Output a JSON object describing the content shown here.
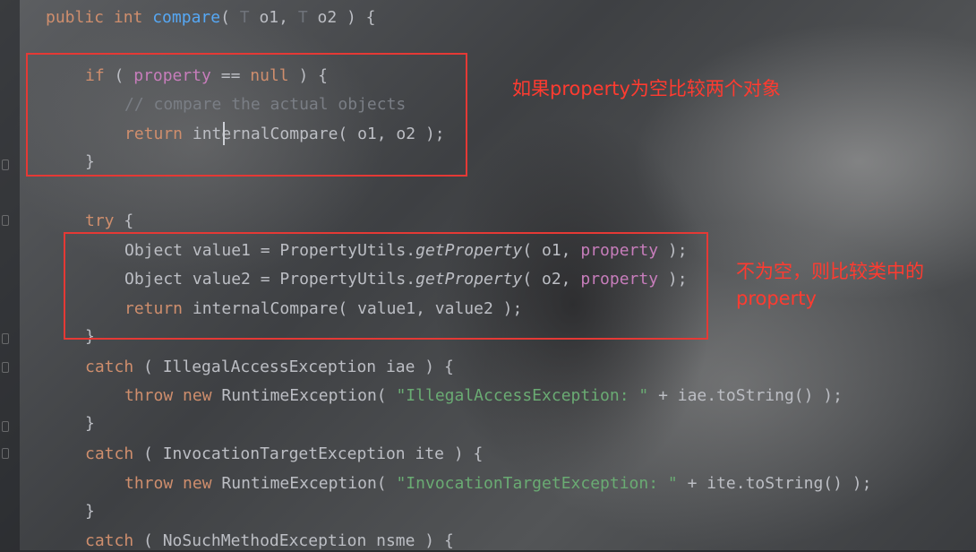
{
  "code_lines": [
    {
      "parts": [
        [
          "kw",
          "public "
        ],
        [
          "kw",
          "int "
        ],
        [
          "fn",
          "compare"
        ],
        [
          "",
          "( "
        ],
        [
          "par",
          "T "
        ],
        [
          "",
          "o1, "
        ],
        [
          "par",
          "T "
        ],
        [
          "",
          "o2 ) {"
        ]
      ]
    },
    {
      "parts": [
        [
          "kw",
          "if "
        ],
        [
          "",
          "( "
        ],
        [
          "fld",
          "property "
        ],
        [
          "",
          "== "
        ],
        [
          "kw",
          "null "
        ],
        [
          "",
          ") {"
        ]
      ]
    },
    {
      "parts": [
        [
          "cm",
          "// compare the actual objects"
        ]
      ]
    },
    {
      "parts": [
        [
          "kw",
          "return "
        ],
        [
          "",
          "internalCompare( o1, o2 );"
        ]
      ]
    },
    {
      "parts": [
        [
          "",
          "}"
        ]
      ]
    },
    {
      "parts": [
        [
          "kw",
          "try "
        ],
        [
          "",
          "{"
        ]
      ]
    },
    {
      "parts": [
        [
          "",
          "Object value1 = PropertyUtils."
        ],
        [
          "mcall",
          "getProperty"
        ],
        [
          "",
          "( o1, "
        ],
        [
          "fld",
          "property "
        ],
        [
          "",
          ");"
        ]
      ]
    },
    {
      "parts": [
        [
          "",
          "Object value2 = PropertyUtils."
        ],
        [
          "mcall",
          "getProperty"
        ],
        [
          "",
          "( o2, "
        ],
        [
          "fld",
          "property "
        ],
        [
          "",
          ");"
        ]
      ]
    },
    {
      "parts": [
        [
          "kw",
          "return "
        ],
        [
          "",
          "internalCompare( value1, value2 );"
        ]
      ]
    },
    {
      "parts": [
        [
          "",
          "}"
        ]
      ]
    },
    {
      "parts": [
        [
          "kw",
          "catch "
        ],
        [
          "",
          "( IllegalAccessException iae ) {"
        ]
      ]
    },
    {
      "parts": [
        [
          "kw",
          "throw "
        ],
        [
          "kw",
          "new "
        ],
        [
          "",
          "RuntimeException( "
        ],
        [
          "str",
          "\"IllegalAccessException: \" "
        ],
        [
          "",
          "+ iae.toString() );"
        ]
      ]
    },
    {
      "parts": [
        [
          "",
          "}"
        ]
      ]
    },
    {
      "parts": [
        [
          "kw",
          "catch "
        ],
        [
          "",
          "( InvocationTargetException ite ) {"
        ]
      ]
    },
    {
      "parts": [
        [
          "kw",
          "throw "
        ],
        [
          "kw",
          "new "
        ],
        [
          "",
          "RuntimeException( "
        ],
        [
          "str",
          "\"InvocationTargetException: \" "
        ],
        [
          "",
          "+ ite.toString() );"
        ]
      ]
    },
    {
      "parts": [
        [
          "",
          "}"
        ]
      ]
    },
    {
      "parts": [
        [
          "kw",
          "catch "
        ],
        [
          "",
          "( NoSuchMethodException nsme ) {"
        ]
      ]
    }
  ],
  "annotations": {
    "note1": "如果property为空比较两个对象",
    "note2_line1": "不为空，则比较类中的",
    "note2_line2": "property"
  },
  "colors": {
    "keyword": "#cf8e6d",
    "method": "#56a8f5",
    "field": "#c77dbb",
    "comment": "#7a7e85",
    "string": "#6aab73",
    "annotation": "#e53935"
  }
}
